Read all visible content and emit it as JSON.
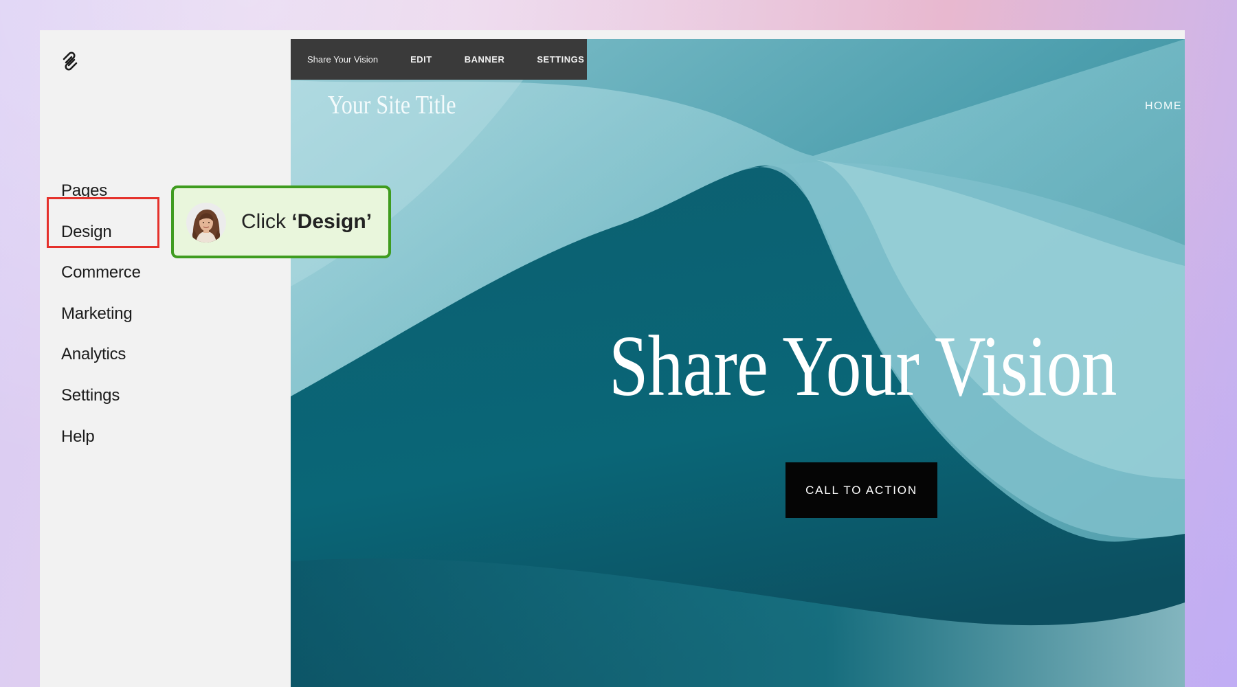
{
  "sidebar": {
    "logo_icon": "squarespace-logo-icon",
    "items": [
      {
        "label": "Pages"
      },
      {
        "label": "Design"
      },
      {
        "label": "Commerce"
      },
      {
        "label": "Marketing"
      },
      {
        "label": "Analytics"
      },
      {
        "label": "Settings"
      },
      {
        "label": "Help"
      }
    ],
    "highlighted_item": "Design",
    "highlight_color": "#e5312b"
  },
  "tooltip": {
    "prefix": "Click",
    "target": "‘Design’",
    "avatar_icon": "guide-avatar",
    "border_color": "#3f9c1f",
    "background_color": "#e9f6dc"
  },
  "preview": {
    "toolbar": {
      "title": "Share Your Vision",
      "edit_label": "EDIT",
      "banner_label": "BANNER",
      "settings_label": "SETTINGS"
    },
    "site_title": "Your Site Title",
    "nav": {
      "home_label": "HOME"
    },
    "hero_heading": "Share Your Vision",
    "cta_label": "CALL TO ACTION",
    "colors": {
      "background": "#2e8796",
      "toolbar": "#3a3a3a",
      "cta_background": "#050505"
    }
  }
}
